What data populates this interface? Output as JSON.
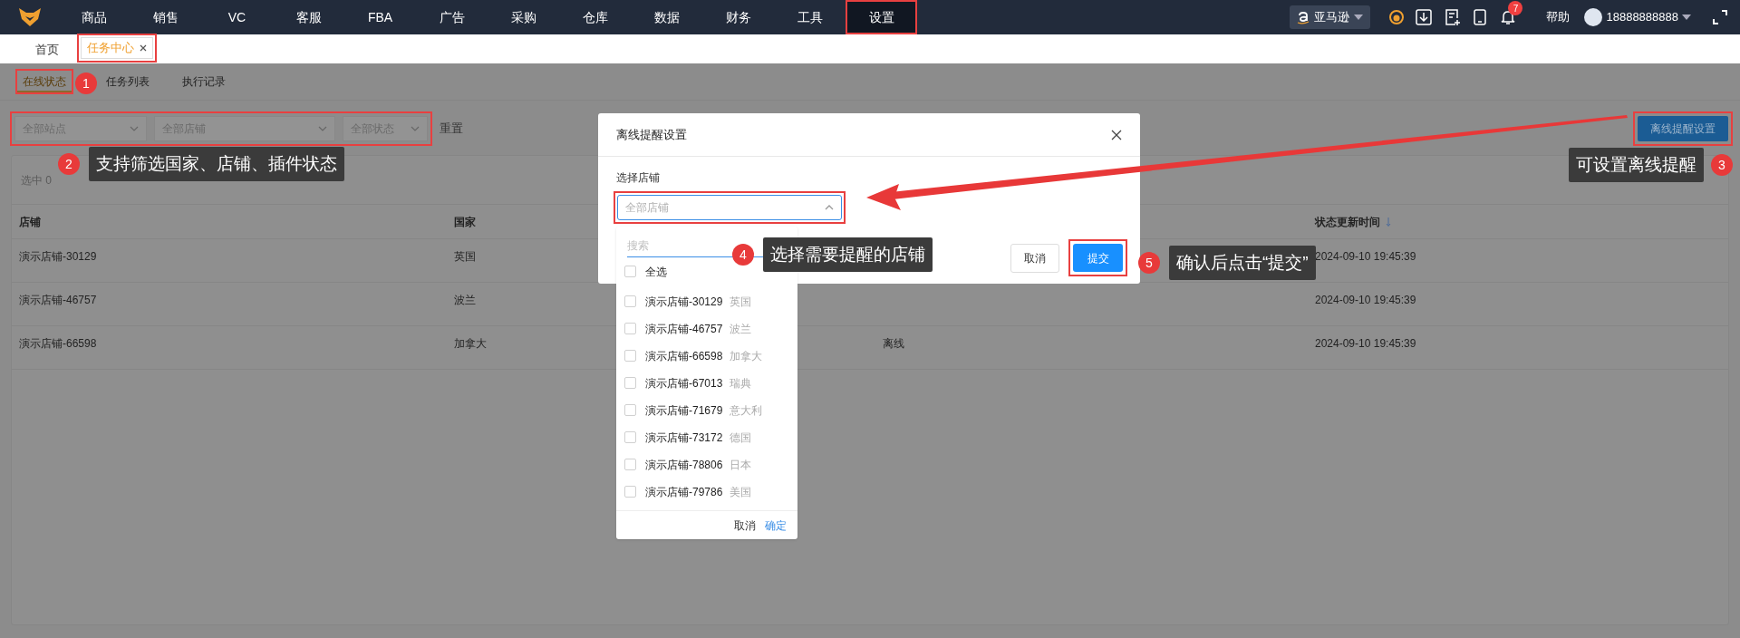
{
  "top_nav": {
    "menu": [
      {
        "label": "商品",
        "selected": false
      },
      {
        "label": "销售",
        "selected": false
      },
      {
        "label": "VC",
        "selected": false
      },
      {
        "label": "客服",
        "selected": false
      },
      {
        "label": "FBA",
        "selected": false
      },
      {
        "label": "广告",
        "selected": false
      },
      {
        "label": "采购",
        "selected": false
      },
      {
        "label": "仓库",
        "selected": false
      },
      {
        "label": "数据",
        "selected": false
      },
      {
        "label": "财务",
        "selected": false
      },
      {
        "label": "工具",
        "selected": false
      },
      {
        "label": "设置",
        "selected": true
      }
    ],
    "platform": "亚马逊",
    "notification_count": "7",
    "help": "帮助",
    "user": "18888888888"
  },
  "page_tabs": [
    {
      "label": "首页",
      "selected": false
    },
    {
      "label": "任务中心",
      "selected": true
    }
  ],
  "sub_tabs": [
    {
      "label": "在线状态",
      "selected": true
    },
    {
      "label": "任务列表",
      "selected": false
    },
    {
      "label": "执行记录",
      "selected": false
    }
  ],
  "filters": {
    "selects": [
      "全部站点",
      "全部店铺",
      "全部状态"
    ],
    "reset": "重置"
  },
  "action_button": "离线提醒设置",
  "summary": "选中 0",
  "table": {
    "columns": [
      "店铺",
      "国家",
      "状态更新时间"
    ],
    "rows": [
      {
        "store": "演示店铺-30129",
        "country": "英国",
        "time": "2024-09-10 19:45:39"
      },
      {
        "store": "演示店铺-46757",
        "country": "波兰",
        "time": "2024-09-10 19:45:39"
      },
      {
        "store": "演示店铺-66598",
        "country": "加拿大",
        "status": "离线",
        "time": "2024-09-10 19:45:39"
      }
    ]
  },
  "dialog": {
    "title": "离线提醒设置",
    "field_label": "选择店铺",
    "select_placeholder": "全部店铺",
    "expanded": true,
    "dropdown": {
      "search_placeholder": "搜索",
      "select_all": {
        "label": "全选",
        "checked": false
      },
      "options": [
        {
          "store": "演示店铺-30129",
          "country": "英国",
          "checked": false
        },
        {
          "store": "演示店铺-46757",
          "country": "波兰",
          "checked": false
        },
        {
          "store": "演示店铺-66598",
          "country": "加拿大",
          "checked": false
        },
        {
          "store": "演示店铺-67013",
          "country": "瑞典",
          "checked": false
        },
        {
          "store": "演示店铺-71679",
          "country": "意大利",
          "checked": false
        },
        {
          "store": "演示店铺-73172",
          "country": "德国",
          "checked": false
        },
        {
          "store": "演示店铺-78806",
          "country": "日本",
          "checked": false
        },
        {
          "store": "演示店铺-79786",
          "country": "美国",
          "checked": false
        }
      ],
      "cancel": "取消",
      "confirm": "确定"
    },
    "cancel": "取消",
    "submit": "提交"
  },
  "annotations": [
    {
      "number": "1"
    },
    {
      "number": "2",
      "text": "支持筛选国家、店铺、插件状态"
    },
    {
      "number": "3",
      "text": "可设置离线提醒"
    },
    {
      "number": "4",
      "text": "选择需要提醒的店铺"
    },
    {
      "number": "5",
      "text": "确认后点击“提交”"
    }
  ]
}
